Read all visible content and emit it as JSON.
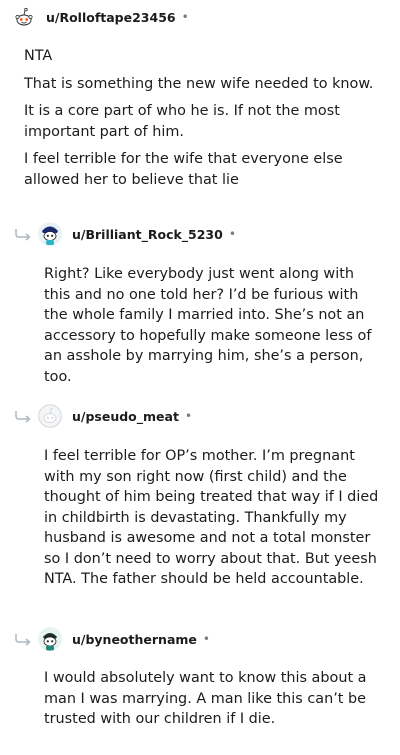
{
  "comments": [
    {
      "username": "u/Rolloftape23456",
      "separator": "•",
      "avatar_icon": "reddit-snoo-icon",
      "paragraphs": [
        "NTA",
        "That is something the new wife needed to know.",
        "It is a core part of who he is. If not the most important part of him.",
        "I feel terrible for the wife that everyone else allowed her to believe that lie"
      ]
    },
    {
      "username": "u/Brilliant_Rock_5230",
      "separator": "•",
      "avatar_icon": "snoo-avatar-icon",
      "paragraphs": [
        "Right? Like everybody just went along with this and no one told her? I’d be furious with the whole family I married into. She’s not an accessory to hopefully make someone less of an asshole by marrying him, she’s a person, too."
      ]
    },
    {
      "username": "u/pseudo_meat",
      "separator": "•",
      "avatar_icon": "default-avatar-icon",
      "paragraphs": [
        "I feel terrible for OP’s mother. I’m pregnant with my son right now (first child) and the thought of him being treated that way if I died in childbirth is devastating. Thankfully my husband is awesome and not a total monster so I don’t need to worry about that. But yeesh NTA. The father should be held accountable."
      ]
    },
    {
      "username": "u/byneothername",
      "separator": "•",
      "avatar_icon": "snoo-avatar-icon",
      "paragraphs": [
        "I would absolutely want to know this about a man I was marrying. A man like this can’t be trusted with our children if I die."
      ]
    }
  ],
  "colors": {
    "text": "#1c1c1c",
    "muted": "#7c7c7c",
    "reply_arrow": "#b0b7bd"
  }
}
